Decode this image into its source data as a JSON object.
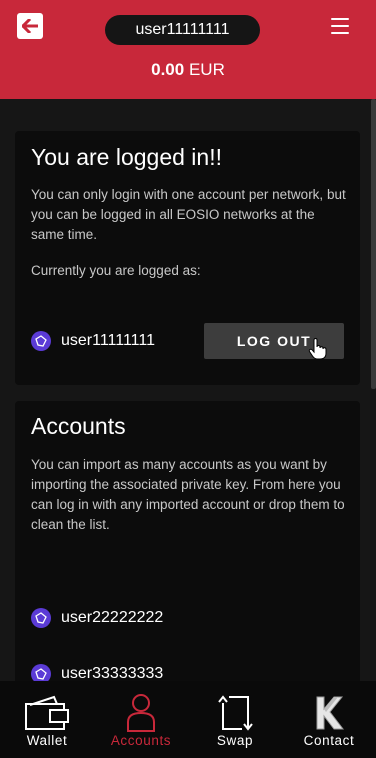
{
  "header": {
    "username": "user11111111",
    "balance_amount": "0.00",
    "balance_currency": "EUR",
    "accent": "#c8283a"
  },
  "login_card": {
    "title": "You are logged in!!",
    "description": "You can only login with one account per network, but you can be logged in all EOSIO networks at the same time.",
    "current_label": "Currently you are logged as:",
    "account": "user11111111",
    "logout_label": "LOG OUT"
  },
  "accounts_card": {
    "title": "Accounts",
    "description": "You can import as many accounts as you want by importing the associated private key. From here you can log in with any imported account or drop them to clean the list.",
    "accounts": [
      "user22222222",
      "user33333333"
    ]
  },
  "bottom_nav": [
    {
      "label": "Wallet",
      "icon": "wallet-icon",
      "active": false
    },
    {
      "label": "Accounts",
      "icon": "user-icon",
      "active": true
    },
    {
      "label": "Swap",
      "icon": "swap-icon",
      "active": false
    },
    {
      "label": "Contact",
      "icon": "k-logo-icon",
      "active": false
    }
  ]
}
